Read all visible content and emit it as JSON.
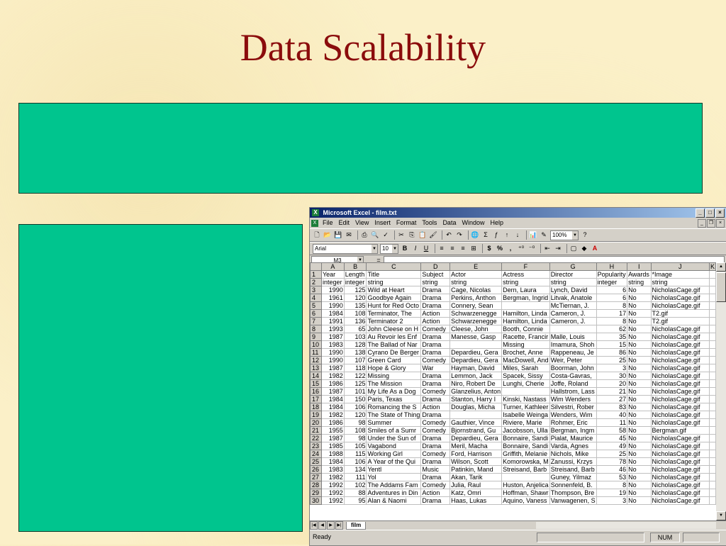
{
  "slide": {
    "title": "Data Scalability"
  },
  "excel": {
    "window_title": "Microsoft Excel - film.txt",
    "menu": [
      "File",
      "Edit",
      "View",
      "Insert",
      "Format",
      "Tools",
      "Data",
      "Window",
      "Help"
    ],
    "zoom": "100%",
    "font_name": "Arial",
    "font_size": "10",
    "name_box": "M3",
    "formula_symbol": "=",
    "columns": [
      "A",
      "B",
      "C",
      "D",
      "E",
      "F",
      "G",
      "H",
      "I",
      "J",
      "K"
    ],
    "rows": [
      [
        "1",
        "Year",
        "Length",
        "Title",
        "Subject",
        "Actor",
        "Actress",
        "Director",
        "Popularity",
        "Awards",
        "*Image"
      ],
      [
        "2",
        "integer",
        "integer",
        "string",
        "string",
        "string",
        "string",
        "string",
        "integer",
        "string",
        "string"
      ],
      [
        "3",
        "1990",
        "125",
        "Wild at Heart",
        "Drama",
        "Cage, Nicolas",
        "Dern, Laura",
        "Lynch, David",
        "6",
        "No",
        "NicholasCage.gif"
      ],
      [
        "4",
        "1961",
        "120",
        "Goodbye Again",
        "Drama",
        "Perkins, Anthon",
        "Bergman, Ingrid",
        "Litvak, Anatole",
        "6",
        "No",
        "NicholasCage.gif"
      ],
      [
        "5",
        "1990",
        "135",
        "Hunt for Red Octo",
        "Drama",
        "Connery, Sean",
        "",
        "McTiernan, J.",
        "8",
        "No",
        "NicholasCage.gif"
      ],
      [
        "6",
        "1984",
        "108",
        "Terminator, The",
        "Action",
        "Schwarzenegge",
        "Hamilton, Linda",
        "Cameron, J.",
        "17",
        "No",
        "T2.gif"
      ],
      [
        "7",
        "1991",
        "136",
        "Terminator 2",
        "Action",
        "Schwarzenegge",
        "Hamilton, Linda",
        "Cameron, J.",
        "8",
        "No",
        "T2.gif"
      ],
      [
        "8",
        "1993",
        "65",
        "John Cleese on H",
        "Comedy",
        "Cleese, John",
        "Booth, Connie",
        "",
        "62",
        "No",
        "NicholasCage.gif"
      ],
      [
        "9",
        "1987",
        "103",
        "Au Revoir les Enf",
        "Drama",
        "Manesse, Gasp",
        "Racette, Francir",
        "Malle, Louis",
        "35",
        "No",
        "NicholasCage.gif"
      ],
      [
        "10",
        "1983",
        "128",
        "The Ballad of Nar",
        "Drama",
        "",
        "Missing",
        "Imamura, Shoh",
        "15",
        "No",
        "NicholasCage.gif"
      ],
      [
        "11",
        "1990",
        "138",
        "Cyrano De Berger",
        "Drama",
        "Depardieu, Gera",
        "Brochet, Anne",
        "Rappeneau, Je",
        "86",
        "No",
        "NicholasCage.gif"
      ],
      [
        "12",
        "1990",
        "107",
        "Green Card",
        "Comedy",
        "Depardieu, Gera",
        "MacDowell, And",
        "Weir, Peter",
        "25",
        "No",
        "NicholasCage.gif"
      ],
      [
        "13",
        "1987",
        "118",
        "Hope & Glory",
        "War",
        "Hayman, David",
        "Miles, Sarah",
        "Boorman, John",
        "3",
        "No",
        "NicholasCage.gif"
      ],
      [
        "14",
        "1982",
        "122",
        "Missing",
        "Drama",
        "Lemmon, Jack",
        "Spacek, Sissy",
        "Costa-Gavras,",
        "30",
        "No",
        "NicholasCage.gif"
      ],
      [
        "15",
        "1986",
        "125",
        "The Mission",
        "Drama",
        "Niro, Robert De",
        "Lunghi, Cherie",
        "Joffe, Roland",
        "20",
        "No",
        "NicholasCage.gif"
      ],
      [
        "16",
        "1987",
        "101",
        "My Life As a Dog",
        "Comedy",
        "Glanzelius, Anton",
        "",
        "Hallstrom, Lass",
        "21",
        "No",
        "NicholasCage.gif"
      ],
      [
        "17",
        "1984",
        "150",
        "Paris, Texas",
        "Drama",
        "Stanton, Harry I",
        "Kinski, Nastass",
        "Wim Wenders",
        "27",
        "No",
        "NicholasCage.gif"
      ],
      [
        "18",
        "1984",
        "106",
        "Romancing the S",
        "Action",
        "Douglas, Micha",
        "Turner, Kathleer",
        "Silvestri, Rober",
        "83",
        "No",
        "NicholasCage.gif"
      ],
      [
        "19",
        "1982",
        "120",
        "The State of Thing",
        "Drama",
        "",
        "Isabelle Weinga",
        "Wenders, Wim",
        "40",
        "No",
        "NicholasCage.gif"
      ],
      [
        "20",
        "1986",
        "98",
        "Summer",
        "Comedy",
        "Gauthier, Vince",
        "Riviere, Marie",
        "Rohmer, Eric",
        "11",
        "No",
        "NicholasCage.gif"
      ],
      [
        "21",
        "1955",
        "108",
        "Smiles of a Sumr",
        "Comedy",
        "Bjornstrand, Gu",
        "Jacobsson, Ulla",
        "Bergman, Ingm",
        "58",
        "No",
        "Bergman.gif"
      ],
      [
        "22",
        "1987",
        "98",
        "Under the Sun of",
        "Drama",
        "Depardieu, Gera",
        "Bonnaire, Sandi",
        "Pialat, Maurice",
        "45",
        "No",
        "NicholasCage.gif"
      ],
      [
        "23",
        "1985",
        "105",
        "Vagabond",
        "Drama",
        "Meril, Macha",
        "Bonnaire, Sandi",
        "Varda, Agnes",
        "49",
        "No",
        "NicholasCage.gif"
      ],
      [
        "24",
        "1988",
        "115",
        "Working Girl",
        "Comedy",
        "Ford, Harrison",
        "Griffith, Melanie",
        "Nichols, Mike",
        "25",
        "No",
        "NicholasCage.gif"
      ],
      [
        "25",
        "1984",
        "106",
        "A Year of the Qui",
        "Drama",
        "Wilson, Scott",
        "Komorowska, M",
        "Zanussi, Krzys",
        "78",
        "No",
        "NicholasCage.gif"
      ],
      [
        "26",
        "1983",
        "134",
        "Yentl",
        "Music",
        "Patinkin, Mand",
        "Streisand, Barb",
        "Streisand, Barb",
        "46",
        "No",
        "NicholasCage.gif"
      ],
      [
        "27",
        "1982",
        "111",
        "Yol",
        "Drama",
        "Akan, Tarik",
        "",
        "Guney, Yilmaz",
        "53",
        "No",
        "NicholasCage.gif"
      ],
      [
        "28",
        "1992",
        "102",
        "The Addams Fam",
        "Comedy",
        "Julia, Raul",
        "Huston, Anjelica",
        "Sonnenfeld, B.",
        "8",
        "No",
        "NicholasCage.gif"
      ],
      [
        "29",
        "1992",
        "88",
        "Adventures in Din",
        "Action",
        "Katz, Omri",
        "Hoffman, Shawr",
        "Thompson, Bre",
        "19",
        "No",
        "NicholasCage.gif"
      ],
      [
        "30",
        "1992",
        "95",
        "Alan & Naomi",
        "Drama",
        "Haas, Lukas",
        "Aquino, Vaness",
        "Vanwagenen, S",
        "3",
        "No",
        "NicholasCage.gif"
      ]
    ],
    "sheet_tab": "film",
    "status": "Ready",
    "status_num": "NUM"
  }
}
